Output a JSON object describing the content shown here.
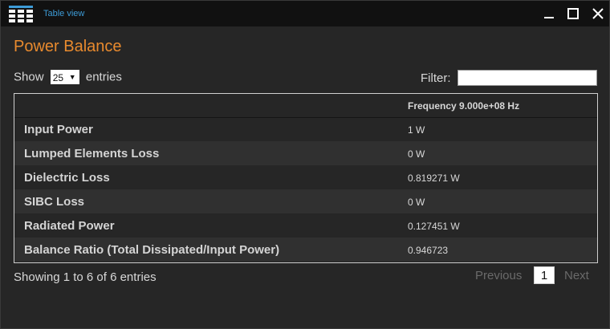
{
  "window": {
    "title": "Table view"
  },
  "page": {
    "heading": "Power Balance"
  },
  "controls": {
    "show_label": "Show",
    "entries_value": "25",
    "entries_label": "entries",
    "filter_label": "Filter:",
    "filter_value": ""
  },
  "table": {
    "column_header": "Frequency 9.000e+08 Hz",
    "rows": [
      {
        "label": "Input Power",
        "value": "1 W"
      },
      {
        "label": "Lumped Elements Loss",
        "value": "0 W"
      },
      {
        "label": "Dielectric Loss",
        "value": "0.819271 W"
      },
      {
        "label": "SIBC Loss",
        "value": "0 W"
      },
      {
        "label": "Radiated Power",
        "value": "0.127451 W"
      },
      {
        "label": "Balance Ratio (Total Dissipated/Input Power)",
        "value": "0.946723"
      }
    ]
  },
  "footer": {
    "info": "Showing 1 to 6 of 6 entries",
    "previous": "Previous",
    "current_page": "1",
    "next": "Next"
  },
  "colors": {
    "accent_heading": "#e88a2e",
    "title_blue": "#3d9bd6"
  },
  "icons": [
    "table-grid-icon",
    "minimize-icon",
    "maximize-icon",
    "close-icon"
  ]
}
